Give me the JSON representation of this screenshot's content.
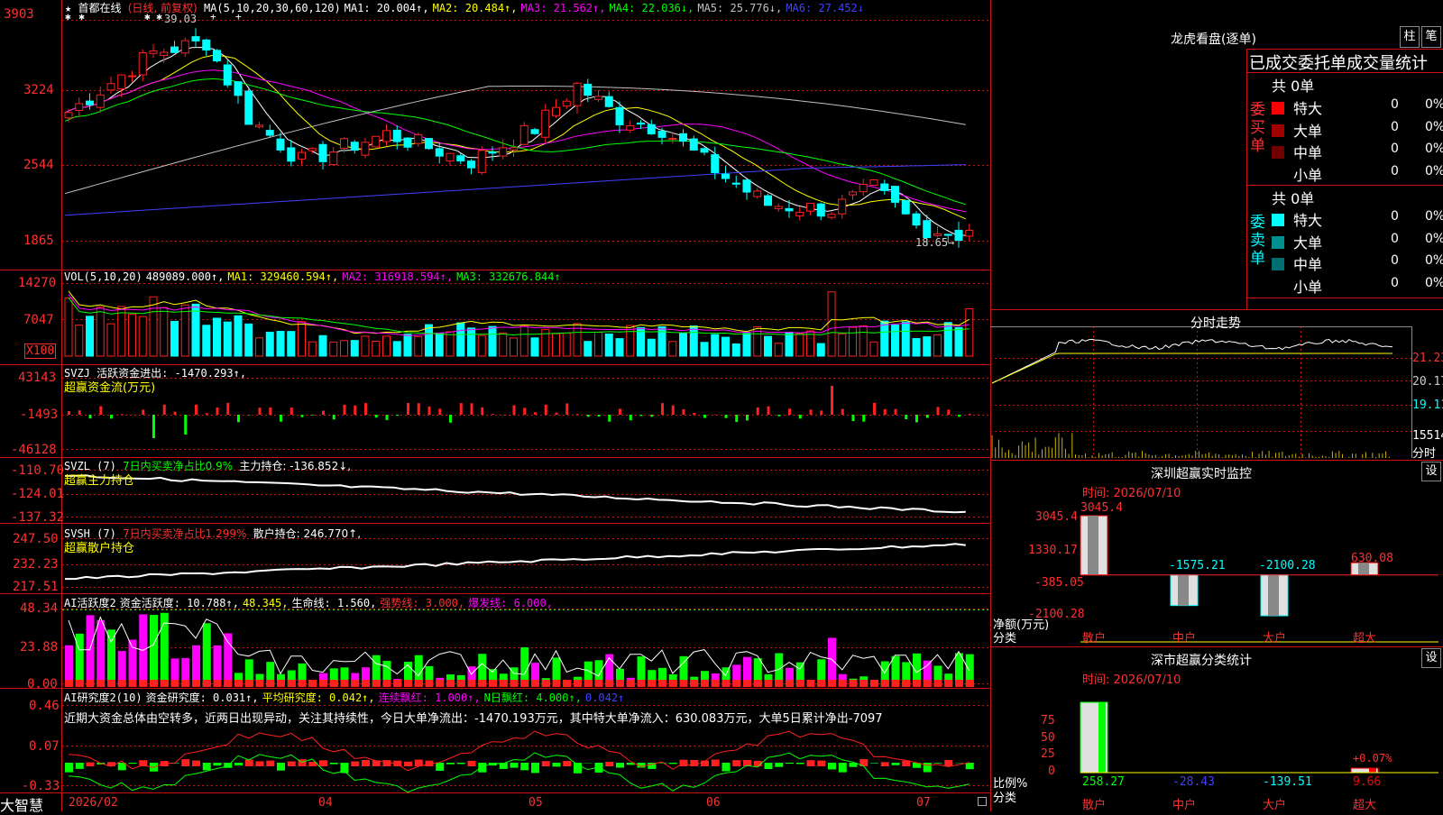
{
  "main": {
    "star": "★",
    "stock_name": "首都在线",
    "period": "(日线, 前复权)",
    "ma_legend": [
      {
        "text": "MA(5,10,20,30,60,120)",
        "color": "#ffffff"
      },
      {
        "text": "MA1: 20.004↑,",
        "color": "#ffffff"
      },
      {
        "text": "MA2: 20.484↑,",
        "color": "#ffff00"
      },
      {
        "text": "MA3: 21.562↑,",
        "color": "#ff00ff"
      },
      {
        "text": "MA4: 22.036↓,",
        "color": "#00ff00"
      },
      {
        "text": "MA5: 25.776↓,",
        "color": "#c0c0c0"
      },
      {
        "text": "MA6: 27.452↓",
        "color": "#4040ff"
      }
    ],
    "y_ticks": [
      "3903",
      "3224",
      "2544",
      "1865"
    ],
    "high_label": "39.03",
    "low_label": "18.65→",
    "marks": [
      "✱",
      "✱",
      "✱",
      "✱",
      "+",
      "+"
    ]
  },
  "vol": {
    "legend": [
      {
        "text": "VOL(5,10,20)",
        "color": "#ffffff"
      },
      {
        "text": "489089.000↑,",
        "color": "#ffffff"
      },
      {
        "text": "MA1: 329460.594↑,",
        "color": "#ffff00"
      },
      {
        "text": "MA2: 316918.594↑,",
        "color": "#ff00ff"
      },
      {
        "text": "MA3: 332676.844↑",
        "color": "#00ff00"
      }
    ],
    "y_ticks": [
      "14270",
      "7047"
    ],
    "unit": "X100"
  },
  "svzj": {
    "line1": "SVZJ  活跃资金进出: -1470.293↑,",
    "line2": "超赢资金流(万元)",
    "y_ticks": [
      "43143",
      "-1493",
      "-46128"
    ]
  },
  "svzl": {
    "l1a": "SVZL (7)",
    "l1b": "7日内买卖净占比0.9%",
    "l1c": "主力持仓: -136.852↓,",
    "line2": "超赢主力持仓",
    "y_ticks": [
      "-110.70",
      "-124.01",
      "-137.32"
    ]
  },
  "svsh": {
    "l1a": "SVSH (7)",
    "l1b": "7日内买卖净占比1.299%",
    "l1c": "散户持仓: 246.770↑,",
    "line2": "超赢散户持仓",
    "y_ticks": [
      "247.50",
      "232.23",
      "217.51"
    ]
  },
  "ai1": {
    "legend": [
      {
        "text": "AI活跃度2",
        "color": "#ffffff"
      },
      {
        "text": "资金活跃度: 10.788↑,",
        "color": "#ffffff"
      },
      {
        "text": "48.345,",
        "color": "#ffff00"
      },
      {
        "text": "生命线: 1.560,",
        "color": "#ffffff"
      },
      {
        "text": "强势线: 3.000,",
        "color": "#ff3030"
      },
      {
        "text": "爆发线: 6.000,",
        "color": "#ff00ff"
      }
    ],
    "y_ticks": [
      "48.34",
      "23.88",
      "0.00"
    ]
  },
  "ai2": {
    "legend": [
      {
        "text": "AI研究度2(10)",
        "color": "#ffffff"
      },
      {
        "text": "资金研究度: 0.031↑,",
        "color": "#ffffff"
      },
      {
        "text": "平均研究度: 0.042↑,",
        "color": "#ffff00"
      },
      {
        "text": "连续飘红: 1.000↑,",
        "color": "#ff00ff"
      },
      {
        "text": "N日飘红: 4.000↑,",
        "color": "#00ff00"
      },
      {
        "text": "0.042↑",
        "color": "#4040ff"
      }
    ],
    "note": "近期大资金总体由空转多，近两日出现异动，关注其持续性，今日大单净流出：-1470.193万元，其中特大单净流入：630.083万元，大单5日累计净出-7097",
    "y_ticks": [
      "0.46",
      "0.07",
      "-0.33"
    ]
  },
  "xaxis": {
    "labels": [
      "2026/02",
      "04",
      "05",
      "06",
      "07"
    ],
    "brand": "大智慧"
  },
  "right": {
    "lhb": {
      "title": "龙虎看盘(逐单)",
      "btn_column": "柱",
      "btn_order": "笔",
      "header": "已成交委托单成交量统计",
      "buy_label": "委买单",
      "sell_label": "委卖单",
      "buy_total": "共 0单",
      "sell_total": "共 0单",
      "buy_rows": [
        {
          "name": "特大",
          "count": "0",
          "pct": "0%",
          "color": "#ff0000"
        },
        {
          "name": "大单",
          "count": "0",
          "pct": "0%",
          "color": "#a00000"
        },
        {
          "name": "中单",
          "count": "0",
          "pct": "0%",
          "color": "#700000"
        },
        {
          "name": "小单",
          "count": "0",
          "pct": "0%",
          "color": ""
        }
      ],
      "sell_rows": [
        {
          "name": "特大",
          "count": "0",
          "pct": "0%",
          "color": "#00ffff"
        },
        {
          "name": "大单",
          "count": "0",
          "pct": "0%",
          "color": "#009090"
        },
        {
          "name": "中单",
          "count": "0",
          "pct": "0%",
          "color": "#006e6e"
        },
        {
          "name": "小单",
          "count": "0",
          "pct": "0%",
          "color": ""
        }
      ]
    },
    "intraday": {
      "title": "分时走势",
      "y_ticks": [
        "21.23",
        "20.17",
        "19.11"
      ],
      "vol_tick": "15514",
      "vol_unit": "分时"
    },
    "monitor": {
      "title": "深圳超赢实时监控",
      "settings": "设",
      "time": "时间: 2026/07/10",
      "y_ticks": [
        "3045.4",
        "1330.17",
        "-385.05",
        "-2100.28"
      ],
      "y_label": "净额(万元)",
      "x_label": "分类",
      "bars": [
        {
          "cat": "散户",
          "value": 3045.4,
          "label": "3045.4",
          "color": "#ff0000"
        },
        {
          "cat": "中户",
          "value": -1575.21,
          "label": "-1575.21",
          "color": "#00ffff"
        },
        {
          "cat": "大户",
          "value": -2100.28,
          "label": "-2100.28",
          "color": "#00ffff"
        },
        {
          "cat": "超大",
          "value": 630.08,
          "label": "630.08",
          "color": "#ff0000"
        }
      ]
    },
    "classify": {
      "title": "深市超赢分类统计",
      "settings": "设",
      "time": "时间: 2026/07/10",
      "y_ticks": [
        "75",
        "50",
        "25",
        "0"
      ],
      "y_label": "比例%",
      "x_label": "分类",
      "bars": [
        {
          "cat": "散户",
          "value": 258.27,
          "label": "258.27",
          "color": "#00ff00"
        },
        {
          "cat": "中户",
          "value": -28.43,
          "label": "-28.43",
          "color": "#4040ff"
        },
        {
          "cat": "大户",
          "value": -139.51,
          "label": "-139.51",
          "color": "#00ffff"
        },
        {
          "cat": "超大",
          "value": 9.66,
          "label": "9.66",
          "color": "#ff0000"
        }
      ],
      "top_label": "+0.07%"
    }
  }
}
